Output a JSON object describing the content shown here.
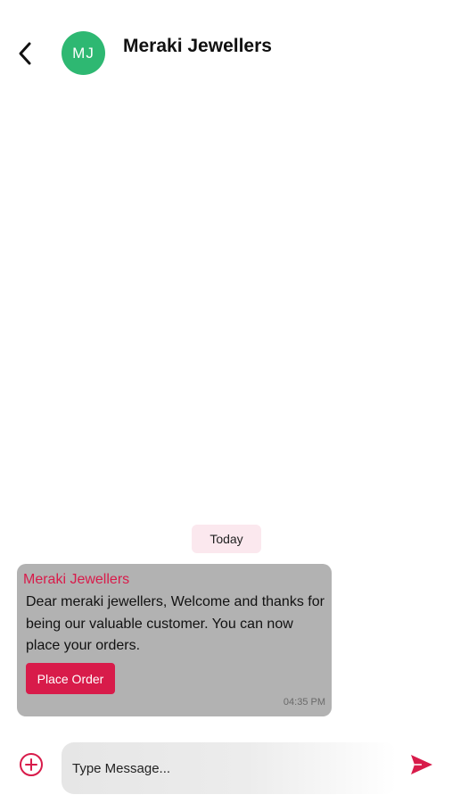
{
  "header": {
    "back_icon": "chevron-left-icon",
    "avatar_initials": "MJ",
    "contact_name": "Meraki Jewellers"
  },
  "conversation": {
    "date_label": "Today",
    "messages": [
      {
        "sender": "Meraki Jewellers",
        "text": "Dear meraki jewellers, Welcome and thanks for being our valuable customer. You can now place your orders.",
        "action_label": "Place Order",
        "time": "04:35 PM"
      }
    ]
  },
  "composer": {
    "add_icon": "plus-circle-icon",
    "placeholder": "Type Message...",
    "value": "",
    "send_icon": "send-icon"
  },
  "colors": {
    "accent": "#d81b4a",
    "avatar_bg": "#2eb872",
    "bubble_bg": "#b2b2b2",
    "date_chip_bg": "#fbe8ee"
  }
}
